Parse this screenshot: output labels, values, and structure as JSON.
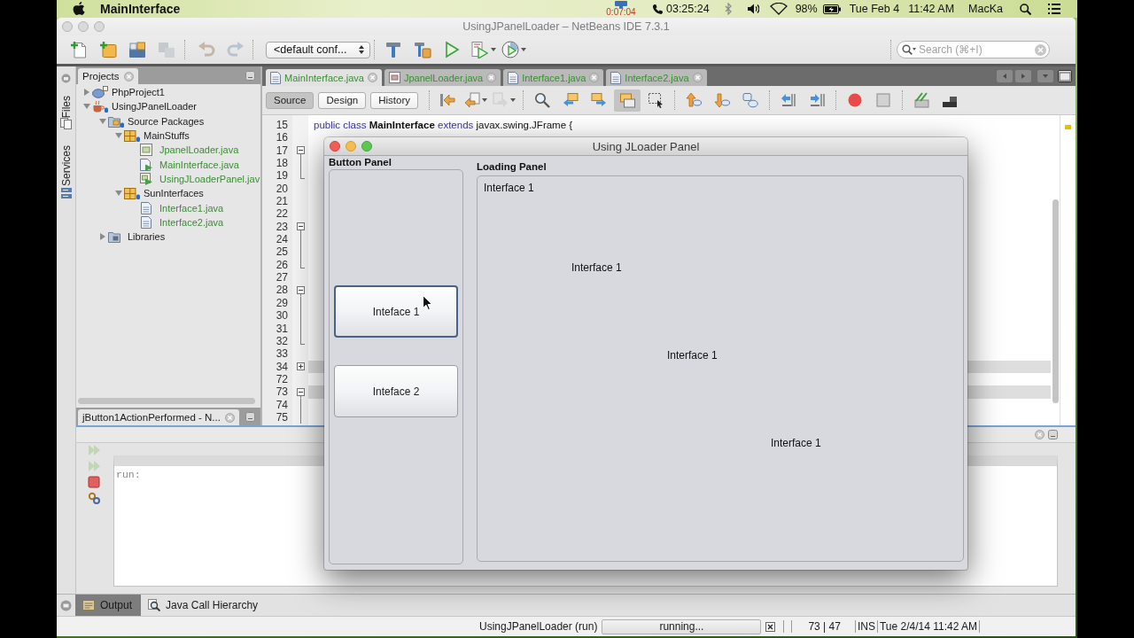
{
  "menu_bar": {
    "app_name": "MainInterface",
    "recording_time": "0:07:04",
    "call_timer": "03:25:24",
    "battery": "98%",
    "date": "Tue Feb 4",
    "time": "11:42 AM",
    "user": "MacKa"
  },
  "window": {
    "title": "UsingJPanelLoader – NetBeans IDE 7.3.1",
    "active": false
  },
  "toolbar": {
    "file_tools": [
      {
        "kind": "new_file",
        "disabled": false
      },
      {
        "kind": "new_project",
        "disabled": false
      },
      {
        "kind": "open_project",
        "disabled": false
      },
      {
        "kind": "close_project",
        "disabled": true
      }
    ],
    "edit_tools": [
      {
        "kind": "undo",
        "disabled": true
      },
      {
        "kind": "redo",
        "disabled": true
      }
    ],
    "configuration": "<default conf...",
    "run_tools": [
      {
        "kind": "build",
        "disabled": false
      },
      {
        "kind": "clean_build",
        "disabled": false
      },
      {
        "kind": "run",
        "disabled": false
      },
      {
        "kind": "debug",
        "disabled": false
      },
      {
        "kind": "profile",
        "disabled": false
      }
    ],
    "search": {
      "placeholder": "Search (⌘+I)"
    }
  },
  "side_tabs": [
    "Files",
    "Services"
  ],
  "projects_panel": {
    "title": "Projects",
    "tree": [
      {
        "label": "PhpProject1",
        "kind": "php_project",
        "expanded": false
      },
      {
        "label": "UsingJPanelLoader",
        "kind": "java_project",
        "expanded": true,
        "children": [
          {
            "label": "Source Packages",
            "kind": "source_root",
            "expanded": true,
            "children": [
              {
                "label": "MainStuffs",
                "kind": "package",
                "expanded": true,
                "children": [
                  {
                    "label": "JpanelLoader.java",
                    "kind": "form_file"
                  },
                  {
                    "label": "MainInterface.java",
                    "kind": "main_file"
                  },
                  {
                    "label": "UsingJLoaderPanel.jav",
                    "kind": "form_main_file"
                  }
                ]
              },
              {
                "label": "SunInterfaces",
                "kind": "package",
                "expanded": true,
                "children": [
                  {
                    "label": "Interface1.java",
                    "kind": "interface_file"
                  },
                  {
                    "label": "Interface2.java",
                    "kind": "interface_file"
                  }
                ]
              }
            ]
          },
          {
            "label": "Libraries",
            "kind": "libraries",
            "expanded": false
          }
        ]
      }
    ]
  },
  "navigator_panel": {
    "title": "jButton1ActionPerformed - N..."
  },
  "editor": {
    "tabs": [
      {
        "label": "MainInterface.java",
        "kind": "source",
        "selected": true
      },
      {
        "label": "JpanelLoader.java",
        "kind": "form",
        "selected": false
      },
      {
        "label": "Interface1.java",
        "kind": "source",
        "selected": false
      },
      {
        "label": "Interface2.java",
        "kind": "source",
        "selected": false
      }
    ],
    "views": [
      {
        "label": "Source",
        "selected": true
      },
      {
        "label": "Design",
        "selected": false
      },
      {
        "label": "History",
        "selected": false
      }
    ],
    "tool_groups": [
      [
        {
          "kind": "last_edit",
          "disabled": false,
          "pressed": false
        },
        {
          "kind": "back",
          "disabled": false,
          "pressed": false
        },
        {
          "kind": "forward",
          "disabled": true,
          "pressed": false
        }
      ],
      [
        {
          "kind": "find_selection",
          "disabled": false,
          "pressed": false
        },
        {
          "kind": "find_previous",
          "disabled": false,
          "pressed": false
        },
        {
          "kind": "find_next",
          "disabled": false,
          "pressed": false
        },
        {
          "kind": "toggle_highlight",
          "disabled": false,
          "pressed": true
        },
        {
          "kind": "rectangular_selection",
          "disabled": false,
          "pressed": false
        }
      ],
      [
        {
          "kind": "previous_bookmark",
          "disabled": false,
          "pressed": false
        },
        {
          "kind": "next_bookmark",
          "disabled": false,
          "pressed": false
        },
        {
          "kind": "toggle_bookmark",
          "disabled": false,
          "pressed": false
        }
      ],
      [
        {
          "kind": "shift_left",
          "disabled": false,
          "pressed": false
        },
        {
          "kind": "shift_right",
          "disabled": false,
          "pressed": false
        }
      ],
      [
        {
          "kind": "start_macro",
          "disabled": false,
          "pressed": false
        },
        {
          "kind": "stop_macro",
          "disabled": false,
          "pressed": false
        }
      ],
      [
        {
          "kind": "comment",
          "disabled": false,
          "pressed": false
        },
        {
          "kind": "uncomment",
          "disabled": false,
          "pressed": false
        }
      ]
    ],
    "lines": [
      {
        "number": "15",
        "kind": "plain",
        "guarded": false,
        "code": [
          {
            "text": "public class",
            "kind": "keyword"
          },
          {
            "text": "MainInterface",
            "kind": "class_name"
          },
          {
            "text": "extends",
            "kind": "keyword"
          },
          {
            "text": "javax.swing.JFrame {",
            "kind": "plain"
          }
        ]
      },
      {
        "number": "16",
        "kind": "plain",
        "guarded": false
      },
      {
        "number": "17",
        "kind": "fold_start",
        "guarded": false
      },
      {
        "number": "18",
        "kind": "fold_body",
        "guarded": false
      },
      {
        "number": "19",
        "kind": "fold_end",
        "guarded": false
      },
      {
        "number": "20",
        "kind": "plain",
        "guarded": false
      },
      {
        "number": "21",
        "kind": "plain",
        "guarded": false
      },
      {
        "number": "22",
        "kind": "plain",
        "guarded": false
      },
      {
        "number": "23",
        "kind": "fold_start",
        "guarded": false
      },
      {
        "number": "24",
        "kind": "fold_body",
        "guarded": false
      },
      {
        "number": "25",
        "kind": "fold_body",
        "guarded": false
      },
      {
        "number": "26",
        "kind": "fold_end",
        "guarded": false
      },
      {
        "number": "27",
        "kind": "plain",
        "guarded": false
      },
      {
        "number": "28",
        "kind": "fold_start",
        "guarded": false
      },
      {
        "number": "29",
        "kind": "fold_body",
        "guarded": false
      },
      {
        "number": "30",
        "kind": "fold_body",
        "guarded": false
      },
      {
        "number": "31",
        "kind": "fold_body",
        "guarded": false
      },
      {
        "number": "32",
        "kind": "fold_end",
        "guarded": false
      },
      {
        "number": "33",
        "kind": "plain",
        "guarded": false
      },
      {
        "number": "34",
        "kind": "folded",
        "guarded": true
      },
      {
        "number": "72",
        "kind": "plain",
        "guarded": false
      },
      {
        "number": "73",
        "kind": "fold_start",
        "guarded": true
      },
      {
        "number": "74",
        "kind": "fold_body",
        "guarded": false
      },
      {
        "number": "75",
        "kind": "fold_body",
        "guarded": false
      }
    ]
  },
  "dialog": {
    "title": "Using JLoader Panel",
    "active": true,
    "button_panel": {
      "title": "Button Panel",
      "buttons": [
        {
          "label": "Inteface 1",
          "focused": true
        },
        {
          "label": "Inteface 2",
          "focused": false
        }
      ]
    },
    "loading_panel": {
      "title": "Loading Panel",
      "labels": [
        "Interface 1",
        "Interface 1",
        "Interface 1",
        "Interface 1"
      ]
    }
  },
  "output_panel": {
    "actions": [
      {
        "kind": "rerun",
        "disabled": true
      },
      {
        "kind": "rerun_with_options",
        "disabled": true
      },
      {
        "kind": "stop",
        "disabled": false
      },
      {
        "kind": "settings",
        "disabled": false
      }
    ],
    "lines": [
      "run:"
    ]
  },
  "bottom_tabs": [
    {
      "label": "Output",
      "selected": true
    },
    {
      "label": "Java Call Hierarchy",
      "selected": false
    }
  ],
  "status_bar": {
    "task": "UsingJPanelLoader (run)",
    "progress": "running...",
    "position": "73 | 47",
    "mode": "INS",
    "timestamp": "Tue 2/4/14 11:42 AM"
  }
}
